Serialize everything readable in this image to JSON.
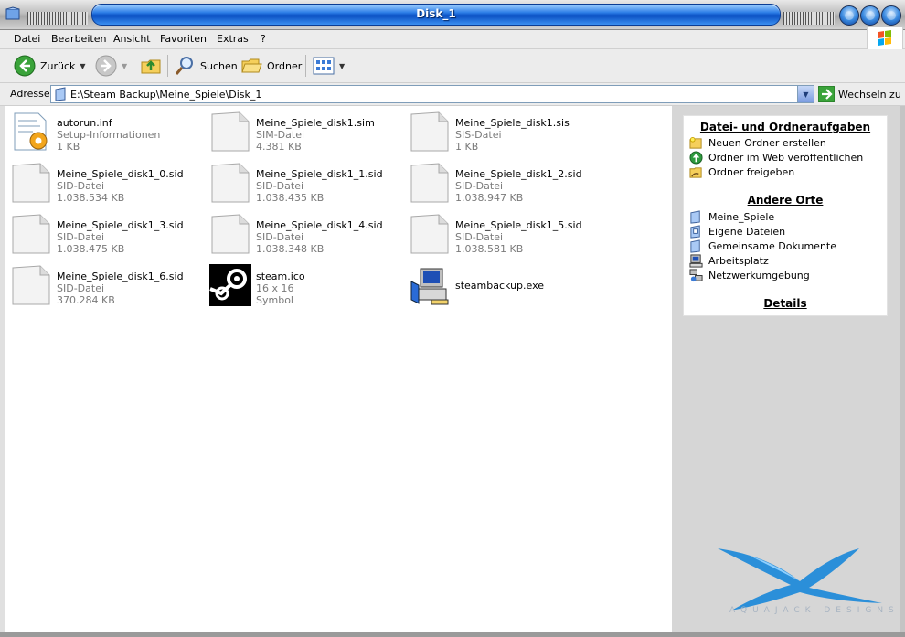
{
  "window": {
    "title": "Disk_1"
  },
  "menu": [
    "Datei",
    "Bearbeiten",
    "Ansicht",
    "Favoriten",
    "Extras",
    "?"
  ],
  "toolbar": {
    "back": "Zurück",
    "search": "Suchen",
    "folders": "Ordner"
  },
  "address": {
    "label": "Adresse",
    "path": "E:\\Steam Backup\\Meine_Spiele\\Disk_1",
    "go": "Wechseln zu"
  },
  "files": [
    {
      "name": "autorun.inf",
      "type": "Setup-Informationen",
      "size": "1 KB",
      "icon": "settings-file-icon"
    },
    {
      "name": "Meine_Spiele_disk1.sim",
      "type": "SIM-Datei",
      "size": "4.381 KB",
      "icon": "generic-file-icon"
    },
    {
      "name": "Meine_Spiele_disk1.sis",
      "type": "SIS-Datei",
      "size": "1 KB",
      "icon": "generic-file-icon"
    },
    {
      "name": "Meine_Spiele_disk1_0.sid",
      "type": "SID-Datei",
      "size": "1.038.534 KB",
      "icon": "generic-file-icon"
    },
    {
      "name": "Meine_Spiele_disk1_1.sid",
      "type": "SID-Datei",
      "size": "1.038.435 KB",
      "icon": "generic-file-icon"
    },
    {
      "name": "Meine_Spiele_disk1_2.sid",
      "type": "SID-Datei",
      "size": "1.038.947 KB",
      "icon": "generic-file-icon"
    },
    {
      "name": "Meine_Spiele_disk1_3.sid",
      "type": "SID-Datei",
      "size": "1.038.475 KB",
      "icon": "generic-file-icon"
    },
    {
      "name": "Meine_Spiele_disk1_4.sid",
      "type": "SID-Datei",
      "size": "1.038.348 KB",
      "icon": "generic-file-icon"
    },
    {
      "name": "Meine_Spiele_disk1_5.sid",
      "type": "SID-Datei",
      "size": "1.038.581 KB",
      "icon": "generic-file-icon"
    },
    {
      "name": "Meine_Spiele_disk1_6.sid",
      "type": "SID-Datei",
      "size": "370.284 KB",
      "icon": "generic-file-icon"
    },
    {
      "name": "steam.ico",
      "type": "16 x 16",
      "size": "Symbol",
      "icon": "steam-icon"
    },
    {
      "name": "steambackup.exe",
      "type": "",
      "size": "",
      "icon": "installer-exe-icon"
    }
  ],
  "taskpane": {
    "tasks_title": "Datei- und Ordneraufgaben",
    "tasks": [
      "Neuen Ordner erstellen",
      "Ordner im Web veröffentlichen",
      "Ordner freigeben"
    ],
    "places_title": "Andere Orte",
    "places": [
      "Meine_Spiele",
      "Eigene Dateien",
      "Gemeinsame Dokumente",
      "Arbeitsplatz",
      "Netzwerkumgebung"
    ],
    "details_title": "Details"
  },
  "brand": "AQUAJACK DESIGNS"
}
